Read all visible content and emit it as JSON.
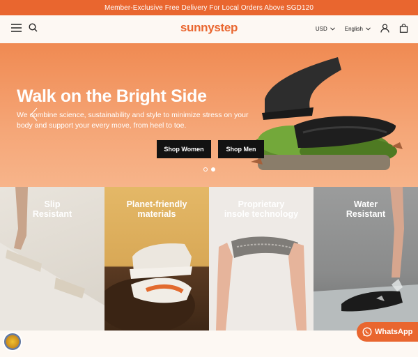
{
  "announcement": "Member-Exclusive Free Delivery For Local Orders Above SGD120",
  "header": {
    "logo": "sunnystep",
    "currency": "USD",
    "language": "English"
  },
  "hero": {
    "title": "Walk on the Bright Side",
    "subtitle": "We combine science, sustainability and style to minimize stress on your body and support your every move, from heel to toe.",
    "cta_women": "Shop Women",
    "cta_men": "Shop Men",
    "slide_count": 2,
    "active_slide": 2
  },
  "tiles": [
    {
      "label_line1": "Slip",
      "label_line2": "Resistant"
    },
    {
      "label_line1": "Planet-friendly",
      "label_line2": "materials"
    },
    {
      "label_line1": "Proprietary",
      "label_line2": "insole technology"
    },
    {
      "label_line1": "Water",
      "label_line2": "Resistant"
    }
  ],
  "whatsapp": "WhatsApp",
  "colors": {
    "accent": "#e9662f",
    "dark": "#121212",
    "bg": "#fdf8f3"
  }
}
